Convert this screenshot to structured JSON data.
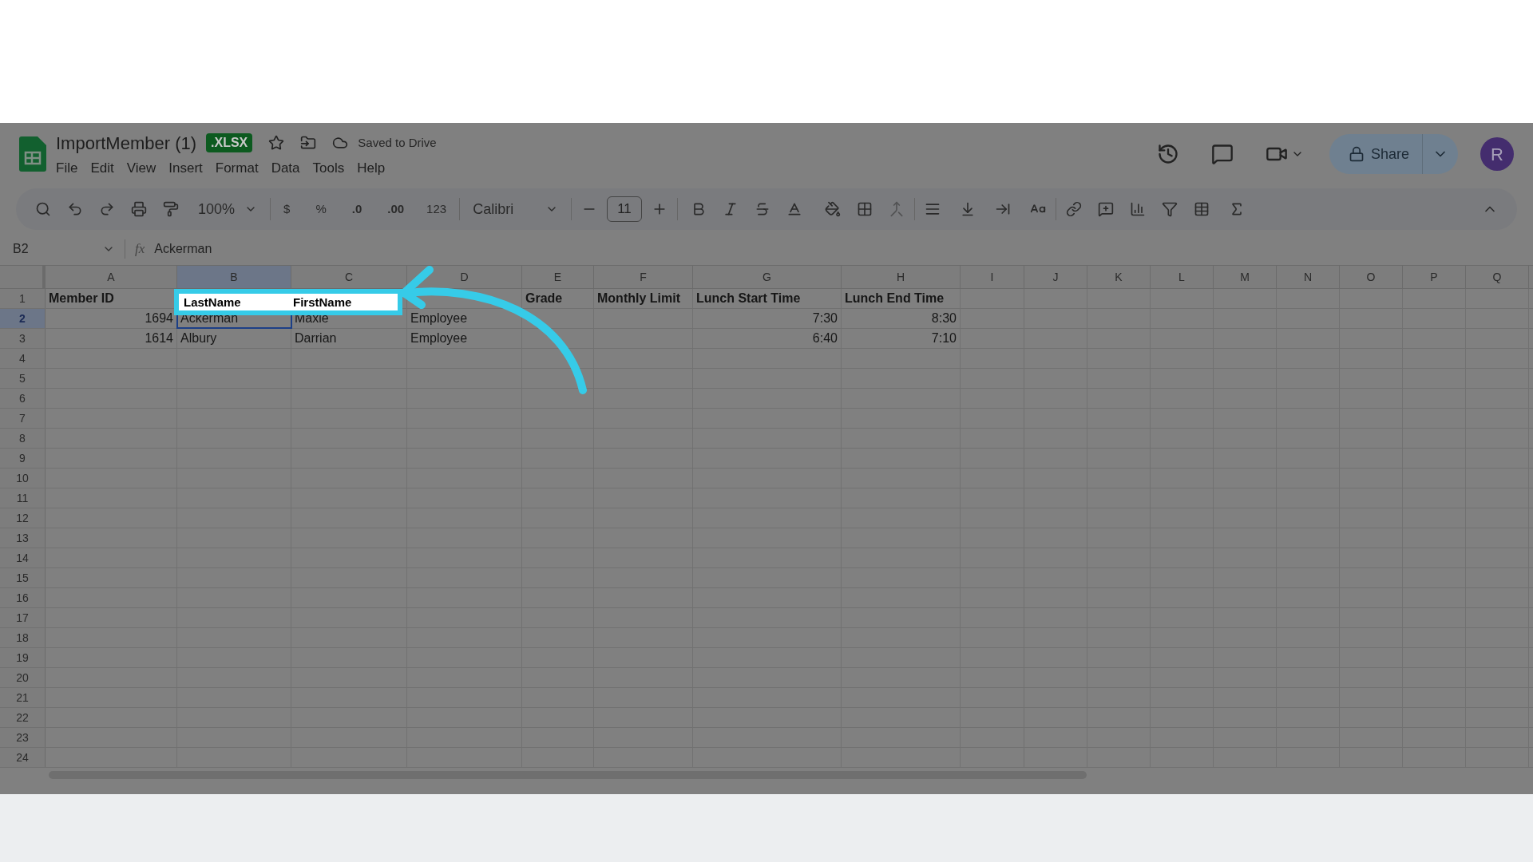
{
  "document": {
    "title": "ImportMember (1)",
    "badge": ".XLSX",
    "status": "Saved to Drive"
  },
  "menu": [
    "File",
    "Edit",
    "View",
    "Insert",
    "Format",
    "Data",
    "Tools",
    "Help"
  ],
  "toolbar": {
    "zoom": "100%",
    "currency": "$",
    "percent": "%",
    "decrease_decimals": ".0",
    "increase_decimals": ".00",
    "number_format": "123",
    "font": "Calibri",
    "font_size": "11"
  },
  "share": {
    "label": "Share"
  },
  "avatar": {
    "initial": "R"
  },
  "formula_bar": {
    "cell": "B2",
    "function_label": "fx",
    "value": "Ackerman"
  },
  "columns": [
    {
      "label": "A",
      "selected": false
    },
    {
      "label": "B",
      "selected": true
    },
    {
      "label": "C",
      "selected": false
    },
    {
      "label": "D",
      "selected": false
    },
    {
      "label": "E",
      "selected": false
    },
    {
      "label": "F",
      "selected": false
    },
    {
      "label": "G",
      "selected": false
    },
    {
      "label": "H",
      "selected": false
    },
    {
      "label": "I",
      "selected": false
    },
    {
      "label": "J",
      "selected": false
    },
    {
      "label": "K",
      "selected": false
    },
    {
      "label": "L",
      "selected": false
    },
    {
      "label": "M",
      "selected": false
    },
    {
      "label": "N",
      "selected": false
    },
    {
      "label": "O",
      "selected": false
    },
    {
      "label": "P",
      "selected": false
    },
    {
      "label": "Q",
      "selected": false
    }
  ],
  "highlight": {
    "cells": [
      "LastName",
      "FirstName"
    ]
  },
  "rows": [
    {
      "number": "1",
      "selected": false,
      "cells": [
        "Member ID",
        "",
        "",
        "",
        "Grade",
        "Monthly Limit",
        "Lunch Start Time",
        "Lunch End Time"
      ]
    },
    {
      "number": "2",
      "selected": true,
      "cells": [
        "1694",
        "Ackerman",
        "Maxie",
        "Employee",
        "",
        "",
        "7:30",
        "8:30"
      ]
    },
    {
      "number": "3",
      "selected": false,
      "cells": [
        "1614",
        "Albury",
        "Darrian",
        "Employee",
        "",
        "",
        "6:40",
        "7:10"
      ]
    },
    {
      "number": "4",
      "selected": false,
      "cells": []
    },
    {
      "number": "5",
      "selected": false,
      "cells": []
    },
    {
      "number": "6",
      "selected": false,
      "cells": []
    },
    {
      "number": "7",
      "selected": false,
      "cells": []
    },
    {
      "number": "8",
      "selected": false,
      "cells": []
    },
    {
      "number": "9",
      "selected": false,
      "cells": []
    },
    {
      "number": "10",
      "selected": false,
      "cells": []
    },
    {
      "number": "11",
      "selected": false,
      "cells": []
    },
    {
      "number": "12",
      "selected": false,
      "cells": []
    },
    {
      "number": "13",
      "selected": false,
      "cells": []
    },
    {
      "number": "14",
      "selected": false,
      "cells": []
    },
    {
      "number": "15",
      "selected": false,
      "cells": []
    },
    {
      "number": "16",
      "selected": false,
      "cells": []
    },
    {
      "number": "17",
      "selected": false,
      "cells": []
    },
    {
      "number": "18",
      "selected": false,
      "cells": []
    },
    {
      "number": "19",
      "selected": false,
      "cells": []
    },
    {
      "number": "20",
      "selected": false,
      "cells": []
    },
    {
      "number": "21",
      "selected": false,
      "cells": []
    },
    {
      "number": "22",
      "selected": false,
      "cells": []
    },
    {
      "number": "23",
      "selected": false,
      "cells": []
    },
    {
      "number": "24",
      "selected": false,
      "cells": []
    }
  ]
}
